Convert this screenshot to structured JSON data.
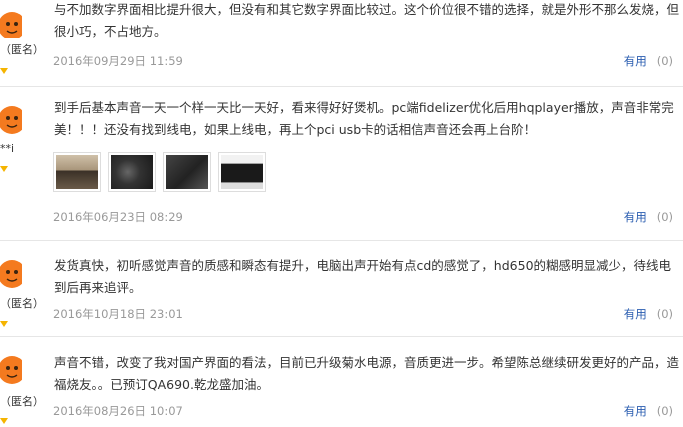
{
  "reviews": [
    {
      "user": "（匿名）",
      "text": "与不加数字界面相比提升很大，但没有和其它数字界面比较过。这个价位很不错的选择，就是外形不那么发烧，但很小巧，不占地方。",
      "time": "2016年09月29日 11:59",
      "helpful_label": "有用",
      "helpful_count": "(0)"
    },
    {
      "user": "**i",
      "text": "到手后基本声音一天一个样一天比一天好，看来得好好煲机。pc端fidelizer优化后用hqplayer播放，声音非常完美！！！还没有找到线电，如果上线电，再上个pci usb卡的话相信声音还会再上台阶！",
      "time": "2016年06月23日 08:29",
      "helpful_label": "有用",
      "helpful_count": "(0)",
      "photos": [
        "photo-1",
        "photo-2",
        "photo-3",
        "photo-4"
      ]
    },
    {
      "user": "（匿名）",
      "text": "发货真快，初听感觉声音的质感和瞬态有提升，电脑出声开始有点cd的感觉了，hd650的糊感明显减少，待线电到后再来追评。",
      "time": "2016年10月18日 23:01",
      "helpful_label": "有用",
      "helpful_count": "(0)"
    },
    {
      "user": "（匿名）",
      "text": "声音不错，改变了我对国产界面的看法，目前已升级菊水电源，音质更进一步。希望陈总继续研发更好的产品，造福烧友。。已预订QA690.乾龙盛加油。",
      "time": "2016年08月26日 10:07",
      "helpful_label": "有用",
      "helpful_count": "(0)"
    }
  ],
  "colors": {
    "avatar": "#f47a1f",
    "link": "#2a5db0",
    "muted": "#999999",
    "badge": "#f5b400"
  },
  "icons": [
    "user-avatar-icon",
    "member-level-icon"
  ]
}
